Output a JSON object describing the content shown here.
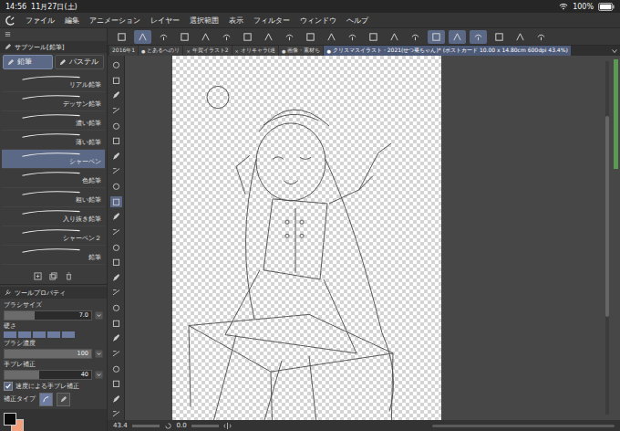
{
  "status_bar": {
    "time": "14:56",
    "date": "11月27日(土)",
    "battery": "100%"
  },
  "menu": [
    "ファイル",
    "編集",
    "アニメーション",
    "レイヤー",
    "選択範囲",
    "表示",
    "フィルター",
    "ウィンドウ",
    "ヘルプ"
  ],
  "command_bar": [
    {
      "active": false
    },
    {
      "active": true
    },
    {
      "active": false
    },
    {
      "active": false
    },
    {
      "active": false
    },
    {
      "active": false
    },
    {
      "active": false
    },
    {
      "active": false
    },
    {
      "active": false
    },
    {
      "active": false
    },
    {
      "active": false
    },
    {
      "active": false
    },
    {
      "active": false
    },
    {
      "active": false
    },
    {
      "active": false
    },
    {
      "active": true
    },
    {
      "active": true
    },
    {
      "active": true
    },
    {
      "active": false
    },
    {
      "active": false
    },
    {
      "active": false
    }
  ],
  "document_tabs": [
    {
      "label": "2016年1",
      "mark": "",
      "selected": false
    },
    {
      "label": "とあるへのリ",
      "mark": "●",
      "selected": false
    },
    {
      "label": "年賀イラスト2",
      "mark": "×",
      "selected": false
    },
    {
      "label": "オリキャラ(迷",
      "mark": "×",
      "selected": false
    },
    {
      "label": "画像・素材ち",
      "mark": "●",
      "selected": false
    },
    {
      "label": "クリスマスイラスト・2021(せつ菜ちゃん)* (ポストカード 10.00 x 14.80cm 600dpi 43.4%)",
      "mark": "●",
      "selected": true
    }
  ],
  "subtool_palette": {
    "title": "サブツール[鉛筆]",
    "tabs": [
      {
        "label": "鉛筆",
        "selected": true
      },
      {
        "label": "パステル",
        "selected": false
      }
    ],
    "brushes": [
      {
        "name": "リアル鉛筆",
        "selected": false
      },
      {
        "name": "デッサン鉛筆",
        "selected": false
      },
      {
        "name": "濃い鉛筆",
        "selected": false
      },
      {
        "name": "薄い鉛筆",
        "selected": false
      },
      {
        "name": "シャーペン",
        "selected": true
      },
      {
        "name": "色鉛筆",
        "selected": false
      },
      {
        "name": "粗い鉛筆",
        "selected": false
      },
      {
        "name": "入り抜き鉛筆",
        "selected": false
      },
      {
        "name": "シャーペン２",
        "selected": false
      },
      {
        "name": "鉛筆",
        "selected": false
      }
    ]
  },
  "tool_property": {
    "title": "ツールプロパティ",
    "properties": [
      {
        "kind": "slider",
        "label": "ブラシサイズ",
        "value": "7.0",
        "level": 0.35
      },
      {
        "kind": "blocks",
        "label": "硬さ",
        "level": 1
      },
      {
        "kind": "slider",
        "label": "ブラシ濃度",
        "value": "100",
        "level": 1
      },
      {
        "kind": "slider",
        "label": "手ブレ補正",
        "value": "40",
        "level": 0.4
      },
      {
        "kind": "checkbox",
        "label": "速度による手ブレ補正",
        "checked": true
      },
      {
        "kind": "type",
        "label": "補正タイプ"
      }
    ]
  },
  "colors": {
    "main": "#0a0a0a",
    "sub": "#f2a07c"
  },
  "canvas_status": {
    "zoom": "43.4",
    "angle": "0.0"
  }
}
